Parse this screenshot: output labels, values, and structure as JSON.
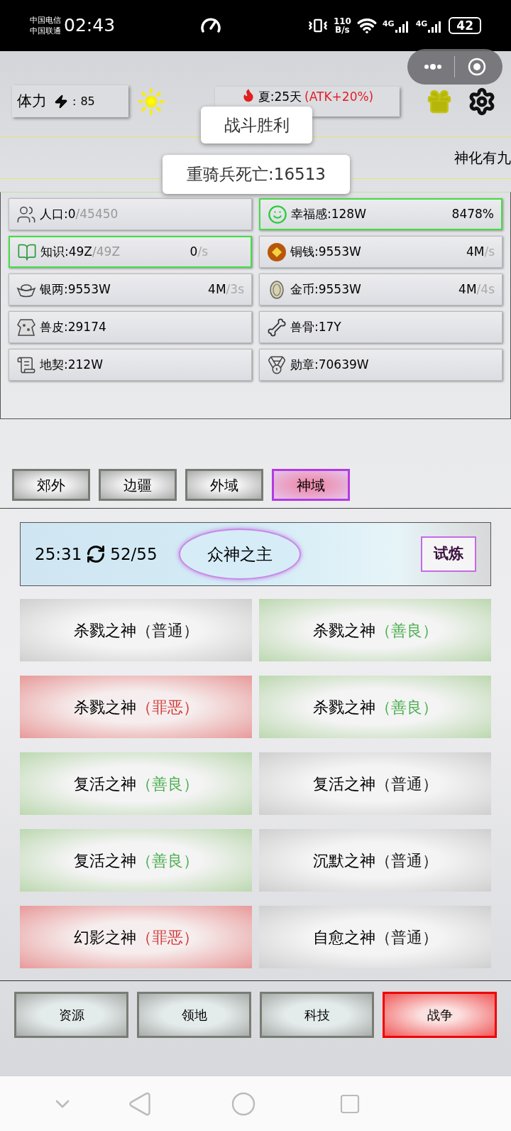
{
  "status_bar": {
    "carriers": [
      "中国电信",
      "中国联通"
    ],
    "time": "02:43",
    "speed": "110",
    "speed_unit": "B/s",
    "networks": [
      "4G",
      "4G"
    ],
    "battery": "42"
  },
  "top_bar": {
    "stamina_label": "体力",
    "stamina_sep": ":",
    "stamina_value": "85",
    "season": "夏:25天",
    "season_bonus": "(ATK+20%)"
  },
  "ticker": "神化有九",
  "toasts": [
    "战斗胜利",
    "重骑兵死亡:16513"
  ],
  "resources": [
    {
      "label": "人口:0",
      "cap": "/45450",
      "highlighted": false
    },
    {
      "label": "幸福感:128W",
      "rate": "8478%",
      "highlighted": true
    },
    {
      "label": "知识:49Z",
      "cap": "/49Z",
      "rate": "0",
      "unit": "/s",
      "highlighted": true
    },
    {
      "label": "铜钱:9553W",
      "rate": "4M",
      "unit": "/s",
      "highlighted": false
    },
    {
      "label": "银两:9553W",
      "rate": "4M",
      "unit": "/3s",
      "highlighted": false
    },
    {
      "label": "金币:9553W",
      "rate": "4M",
      "unit": "/4s",
      "highlighted": false
    },
    {
      "label": "兽皮:29174",
      "highlighted": false
    },
    {
      "label": "兽骨:17Y",
      "highlighted": false
    },
    {
      "label": "地契:212W",
      "highlighted": false
    },
    {
      "label": "勋章:70639W",
      "highlighted": false
    }
  ],
  "region_tabs": [
    {
      "label": "郊外",
      "selected": false
    },
    {
      "label": "边疆",
      "selected": false
    },
    {
      "label": "外域",
      "selected": false
    },
    {
      "label": "神域",
      "selected": true
    }
  ],
  "boss_banner": {
    "timer": "25:31",
    "count": "52/55",
    "boss": "众神之主",
    "action": "试炼"
  },
  "enemies": [
    {
      "name": "杀戮之神",
      "tag": "（普通）",
      "kind": "normal"
    },
    {
      "name": "杀戮之神",
      "tag": "（善良）",
      "kind": "good"
    },
    {
      "name": "杀戮之神",
      "tag": "（罪恶）",
      "kind": "evil"
    },
    {
      "name": "杀戮之神",
      "tag": "（善良）",
      "kind": "good"
    },
    {
      "name": "复活之神",
      "tag": "（善良）",
      "kind": "good"
    },
    {
      "name": "复活之神",
      "tag": "（普通）",
      "kind": "normal"
    },
    {
      "name": "复活之神",
      "tag": "（善良）",
      "kind": "good"
    },
    {
      "name": "沉默之神",
      "tag": "（普通）",
      "kind": "normal"
    },
    {
      "name": "幻影之神",
      "tag": "（罪恶）",
      "kind": "evil"
    },
    {
      "name": "自愈之神",
      "tag": "（普通）",
      "kind": "normal"
    }
  ],
  "bottom_nav": [
    {
      "label": "资源",
      "selected": false
    },
    {
      "label": "领地",
      "selected": false
    },
    {
      "label": "科技",
      "selected": false
    },
    {
      "label": "战争",
      "selected": true
    }
  ]
}
